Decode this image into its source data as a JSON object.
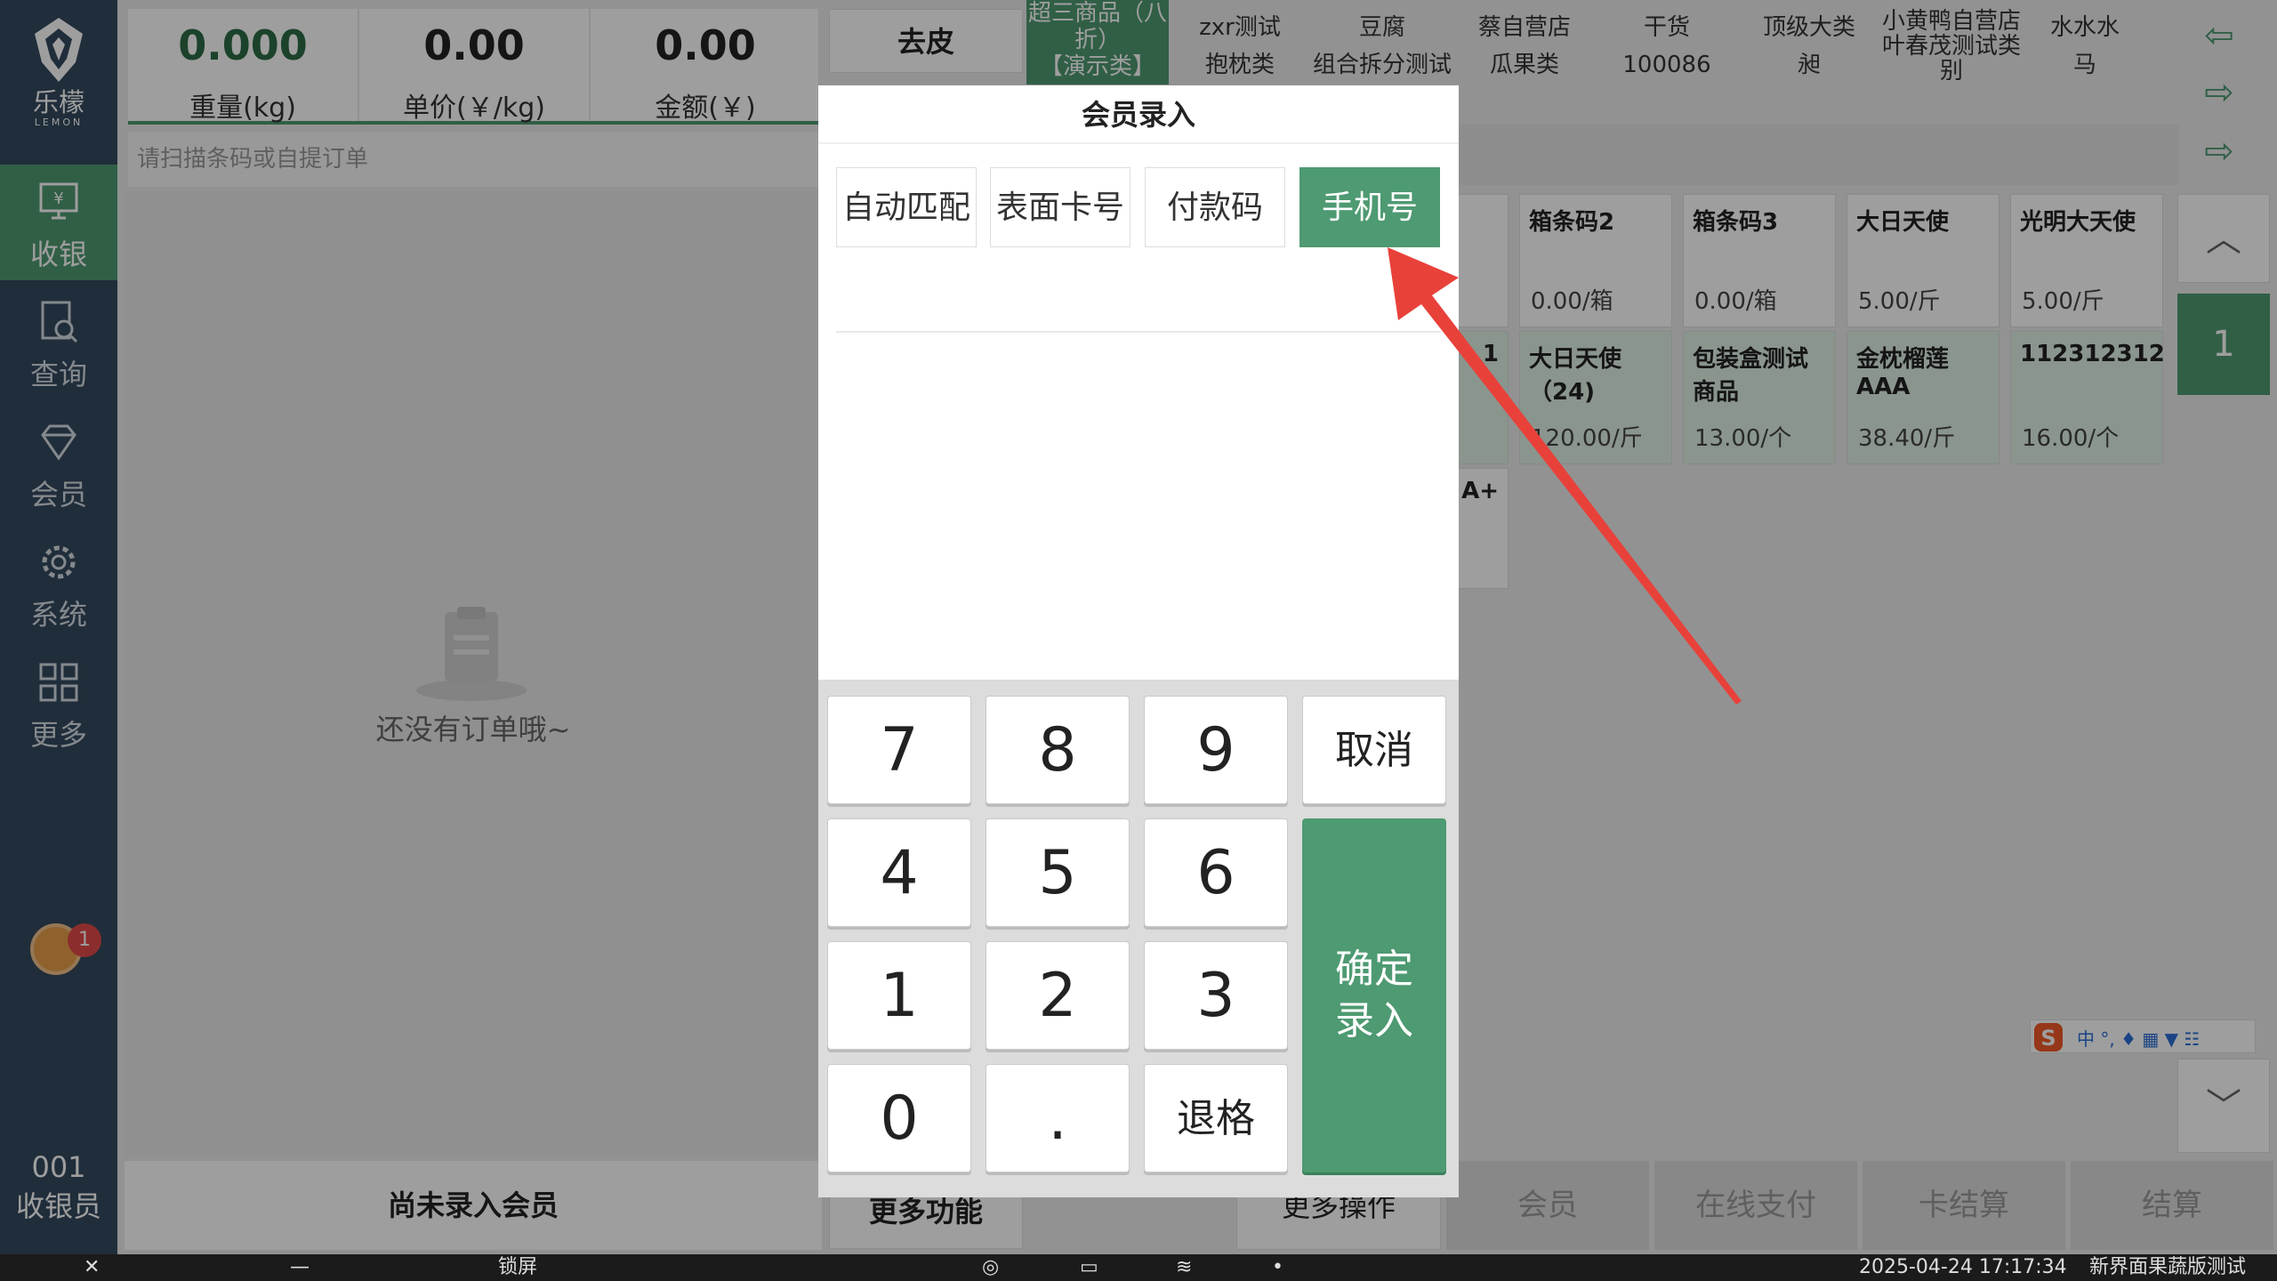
{
  "brand": {
    "name": "乐檬",
    "sub": "LEMON"
  },
  "nav": [
    {
      "label": "收银",
      "icon": "cashier-icon"
    },
    {
      "label": "查询",
      "icon": "search-icon"
    },
    {
      "label": "会员",
      "icon": "diamond-icon"
    },
    {
      "label": "系统",
      "icon": "gear-icon"
    },
    {
      "label": "更多",
      "icon": "grid-icon"
    }
  ],
  "notification_count": "1",
  "cashier": {
    "id": "001",
    "role": "收银员"
  },
  "metrics": [
    {
      "value": "0.000",
      "label": "重量(kg)"
    },
    {
      "value": "0.00",
      "label": "单价(￥/kg)"
    },
    {
      "value": "0.00",
      "label": "金额(￥)"
    }
  ],
  "tare_label": "去皮",
  "scan_placeholder": "请扫描条码或自提订单",
  "empty_text": "还没有订单哦~",
  "member_status": "尚未录入会员",
  "more_functions": "更多功能",
  "more_ops": "更多操作",
  "categories": [
    {
      "l1": "超三商品（八折）",
      "l2": "【演示类】",
      "highlight": true
    },
    {
      "l1": "zxr测试",
      "l2": "抱枕类"
    },
    {
      "l1": "豆腐",
      "l2": "组合拆分测试"
    },
    {
      "l1": "蔡自营店",
      "l2": "瓜果类"
    },
    {
      "l1": "干货",
      "l2": "100086"
    },
    {
      "l1": "顶级大类",
      "l2": "昶"
    },
    {
      "l1": "小黄鸭自营店",
      "l2": "叶春茂测试类别"
    },
    {
      "l1": "水水水",
      "l2": "马"
    }
  ],
  "products_row1": [
    {
      "name": "箱条码2",
      "price": "0.00/箱"
    },
    {
      "name": "箱条码3",
      "price": "0.00/箱"
    },
    {
      "name": "大日天使",
      "price": "5.00/斤"
    },
    {
      "name": "光明大天使",
      "price": "5.00/斤"
    }
  ],
  "products_row2": [
    {
      "name": "大日天使（24)",
      "price": "120.00/斤"
    },
    {
      "name": "包装盒测试商品",
      "price": "13.00/个"
    },
    {
      "name": "金枕榴莲AAA",
      "price": "38.40/斤"
    },
    {
      "name": "112312312",
      "price": "16.00/个"
    }
  ],
  "partial_tiles": {
    "row2": "1",
    "row3": "A+"
  },
  "page_number": "1",
  "bottom_actions": [
    "会员",
    "在线支付",
    "卡结算",
    "结算"
  ],
  "status_bar": {
    "lock": "锁屏",
    "datetime": "2025-04-24 17:17:34",
    "store": "新界面果蔬版测试"
  },
  "modal": {
    "title": "会员录入",
    "tabs": [
      "自动匹配",
      "表面卡号",
      "付款码",
      "手机号"
    ],
    "active_tab": "手机号",
    "keys": {
      "k7": "7",
      "k8": "8",
      "k9": "9",
      "cancel": "取消",
      "k4": "4",
      "k5": "5",
      "k6": "6",
      "k1": "1",
      "k2": "2",
      "k3": "3",
      "k0": "0",
      "dot": ".",
      "backspace": "退格",
      "confirm": "确定录入"
    }
  },
  "colors": {
    "accent": "#4e9a72",
    "sidebar": "#34495e",
    "arrow": "#e8413a"
  }
}
